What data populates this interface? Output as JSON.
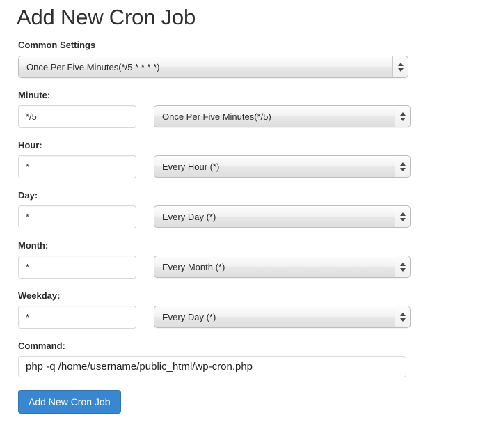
{
  "page": {
    "title": "Add New Cron Job"
  },
  "common_settings": {
    "label": "Common Settings",
    "value": "Once Per Five Minutes(*/5 * * * *)"
  },
  "fields": [
    {
      "label": "Minute:",
      "input_value": "*/5",
      "select_value": "Once Per Five Minutes(*/5)"
    },
    {
      "label": "Hour:",
      "input_value": "*",
      "select_value": "Every Hour (*)"
    },
    {
      "label": "Day:",
      "input_value": "*",
      "select_value": "Every Day (*)"
    },
    {
      "label": "Month:",
      "input_value": "*",
      "select_value": "Every Month (*)"
    },
    {
      "label": "Weekday:",
      "input_value": "*",
      "select_value": "Every Day (*)"
    }
  ],
  "command": {
    "label": "Command:",
    "value": "php -q /home/username/public_html/wp-cron.php"
  },
  "submit": {
    "label": "Add New Cron Job"
  },
  "colors": {
    "button_primary": "#3a87d1",
    "text": "#333333",
    "input_border": "#d8d8d8",
    "select_border": "#bdbdbd"
  }
}
